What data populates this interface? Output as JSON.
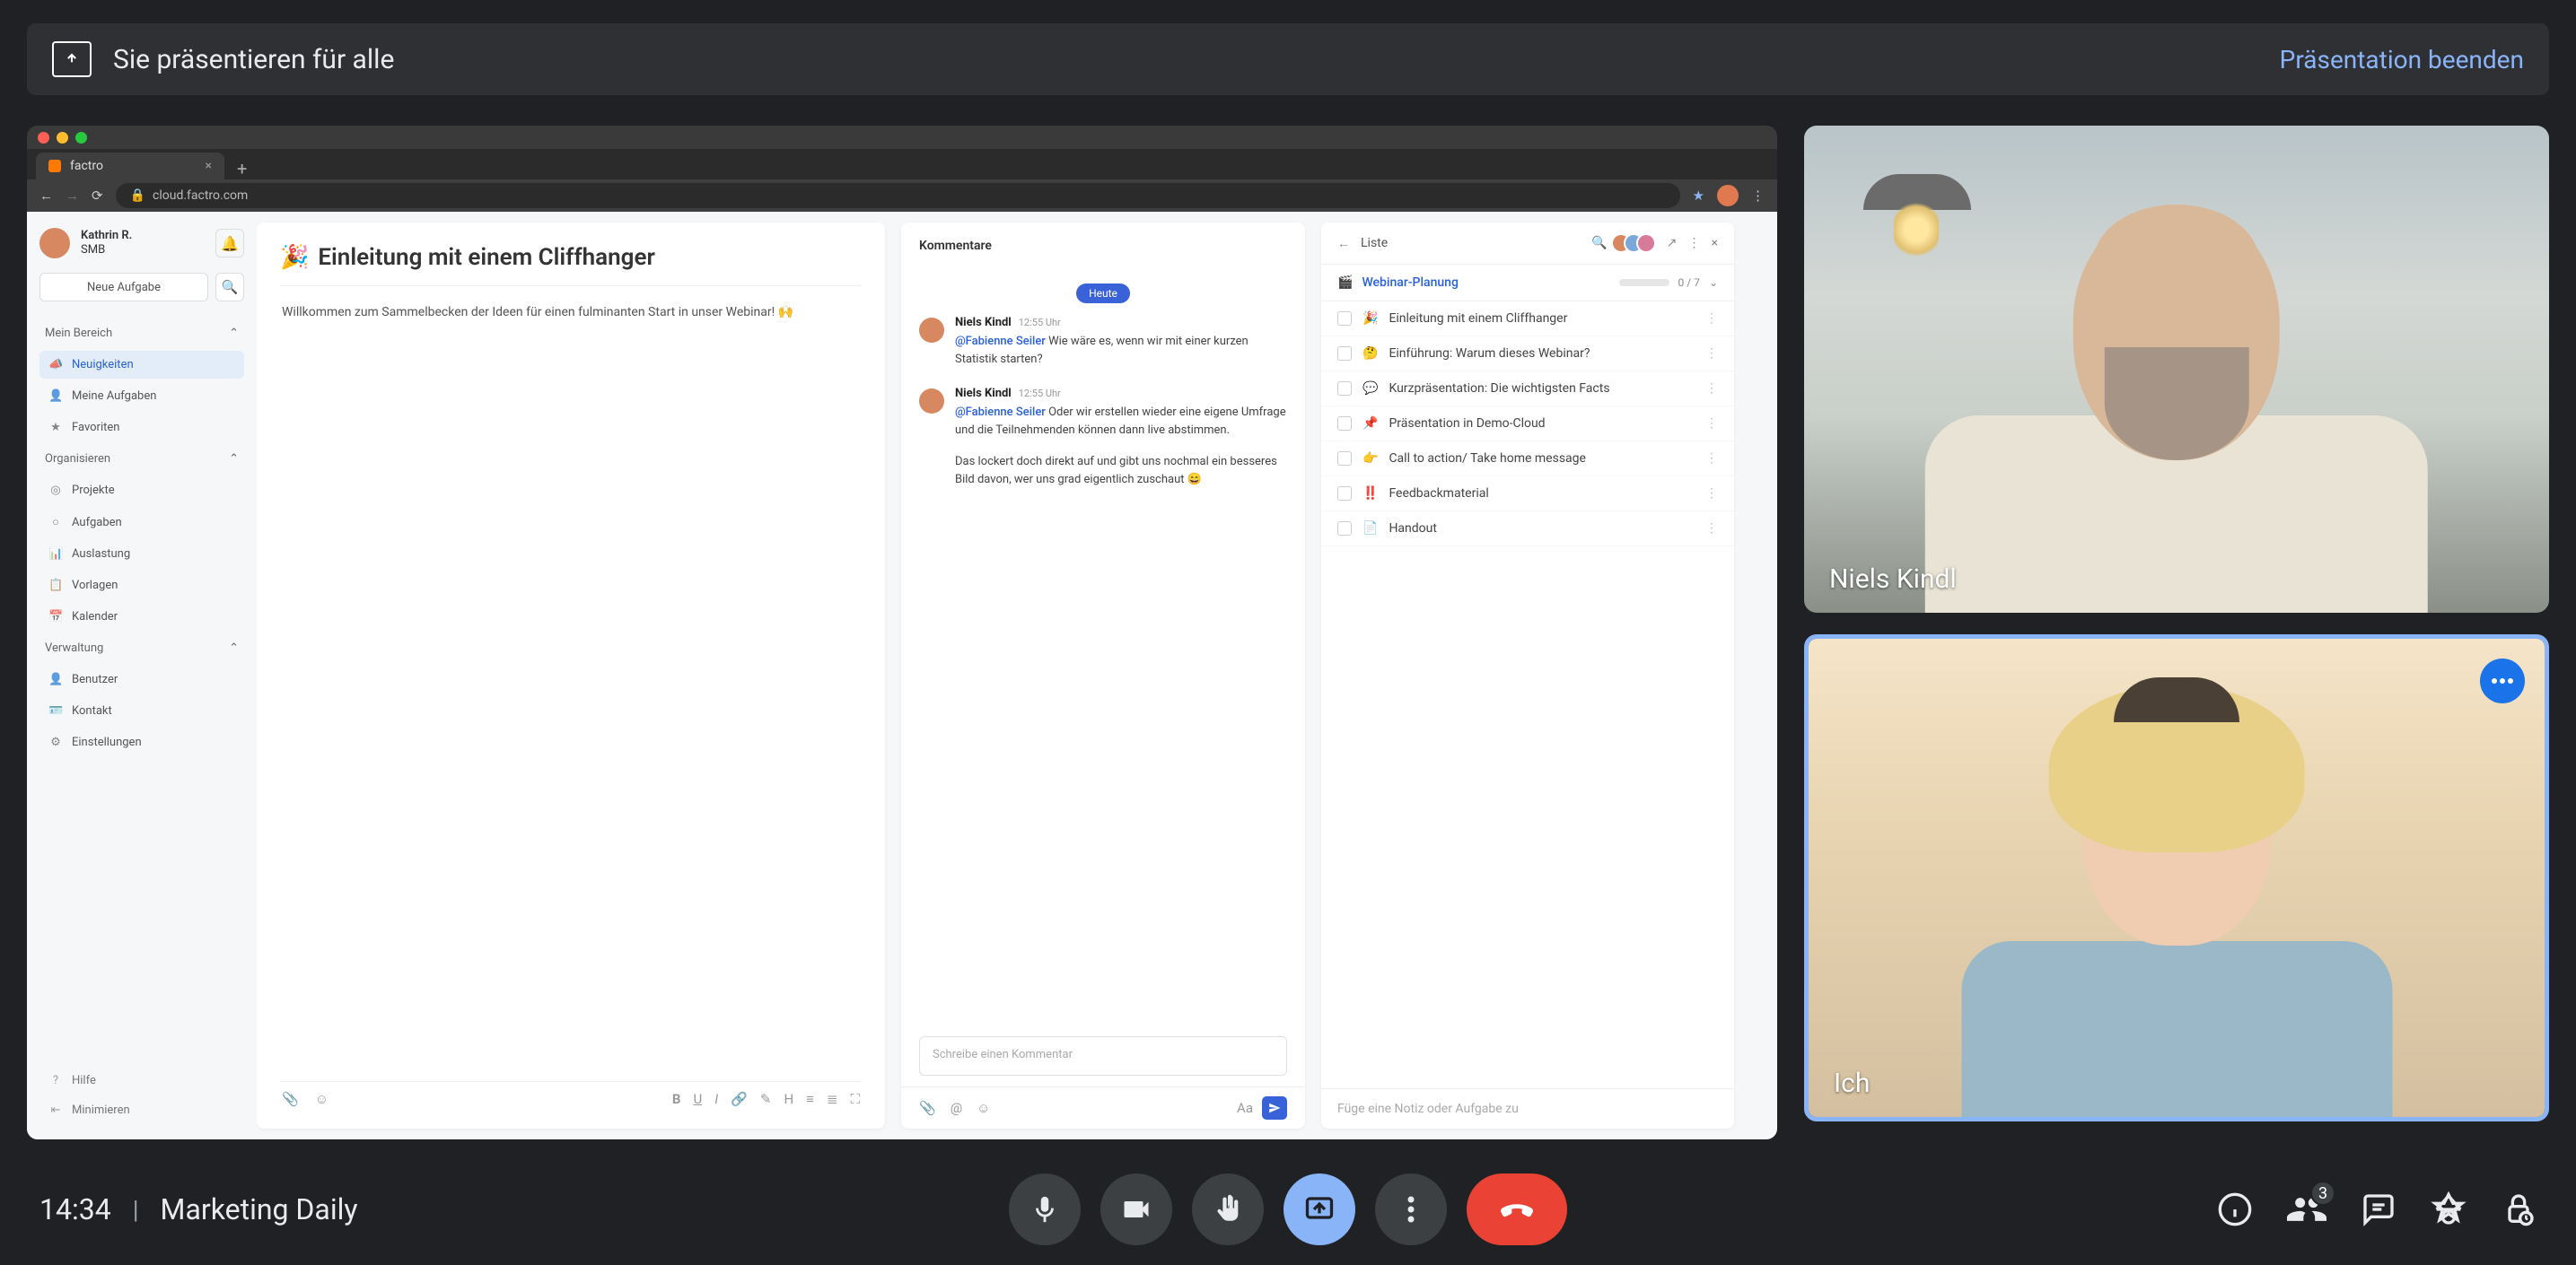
{
  "banner": {
    "text": "Sie präsentieren für alle",
    "stop": "Präsentation beenden"
  },
  "videos": {
    "remote_name": "Niels Kindl",
    "self_name": "Ich"
  },
  "bottom": {
    "time": "14:34",
    "meeting": "Marketing Daily",
    "people_badge": "3"
  },
  "browser": {
    "tab_title": "factro",
    "url": "cloud.factro.com"
  },
  "factro": {
    "user": {
      "name": "Kathrin R.",
      "sub": "SMB"
    },
    "newtask": "Neue Aufgabe",
    "sections": {
      "mein_bereich": "Mein Bereich",
      "organisieren": "Organisieren",
      "verwaltung": "Verwaltung"
    },
    "nav": {
      "neuigkeiten": "Neuigkeiten",
      "meine_aufgaben": "Meine Aufgaben",
      "favoriten": "Favoriten",
      "projekte": "Projekte",
      "aufgaben": "Aufgaben",
      "auslastung": "Auslastung",
      "vorlagen": "Vorlagen",
      "kalender": "Kalender",
      "benutzer": "Benutzer",
      "kontakt": "Kontakt",
      "einstellungen": "Einstellungen",
      "hilfe": "Hilfe",
      "minimieren": "Minimieren"
    },
    "detail": {
      "emoji": "🎉",
      "title": "Einleitung mit einem Cliffhanger",
      "body": "Willkommen zum Sammelbecken der Ideen für einen fulminanten Start in unser Webinar! 🙌"
    },
    "comments": {
      "heading": "Kommentare",
      "date": "Heute",
      "c1": {
        "author": "Niels Kindl",
        "time": "12:55 Uhr",
        "mention": "@Fabienne Seiler",
        "text": " Wie wäre es, wenn wir mit einer kurzen Statistik starten?"
      },
      "c2": {
        "author": "Niels Kindl",
        "time": "12:55 Uhr",
        "mention": "@Fabienne Seiler",
        "text": " Oder wir erstellen wieder eine eigene Umfrage und die Teilnehmenden können dann live abstimmen."
      },
      "c2b": "Das lockert doch direkt auf und gibt uns nochmal ein besseres Bild davon, wer uns grad eigentlich zuschaut 😄",
      "placeholder": "Schreibe einen Kommentar"
    },
    "list": {
      "title": "Liste",
      "project": "Webinar-Planung",
      "progress": "0 / 7",
      "tasks": [
        {
          "e": "🎉",
          "t": "Einleitung mit einem Cliffhanger"
        },
        {
          "e": "🤔",
          "t": "Einführung: Warum dieses Webinar?"
        },
        {
          "e": "💬",
          "t": "Kurzpräsentation: Die wichtigsten Facts"
        },
        {
          "e": "📌",
          "t": "Präsentation in Demo-Cloud"
        },
        {
          "e": "👉",
          "t": "Call to action/ Take home message"
        },
        {
          "e": "‼️",
          "t": "Feedbackmaterial"
        },
        {
          "e": "📄",
          "t": "Handout"
        }
      ],
      "footer": "Füge eine Notiz oder Aufgabe zu"
    }
  }
}
